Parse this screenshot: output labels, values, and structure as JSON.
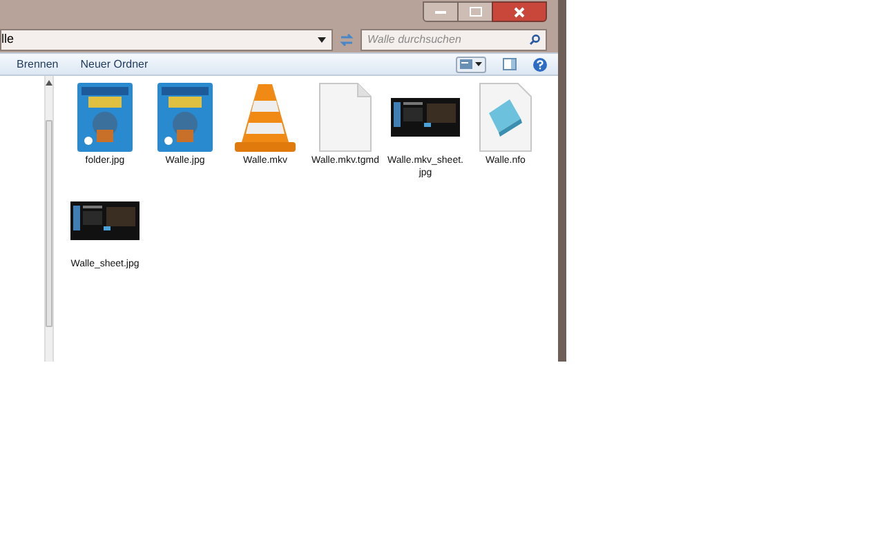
{
  "address_bar": {
    "path": "lle"
  },
  "search": {
    "placeholder": "Walle durchsuchen"
  },
  "toolbar": {
    "buttons": [
      "Brennen",
      "Neuer Ordner"
    ]
  },
  "files": [
    {
      "name": "folder.jpg",
      "kind": "poster"
    },
    {
      "name": "Walle.jpg",
      "kind": "poster"
    },
    {
      "name": "Walle.mkv",
      "kind": "cone"
    },
    {
      "name": "Walle.mkv.tgmd",
      "kind": "blank"
    },
    {
      "name": "Walle.mkv_sheet.\njpg",
      "kind": "sheet"
    },
    {
      "name": "Walle.nfo",
      "kind": "notepad"
    },
    {
      "name": "Walle_sheet.jpg",
      "kind": "sheet"
    }
  ]
}
